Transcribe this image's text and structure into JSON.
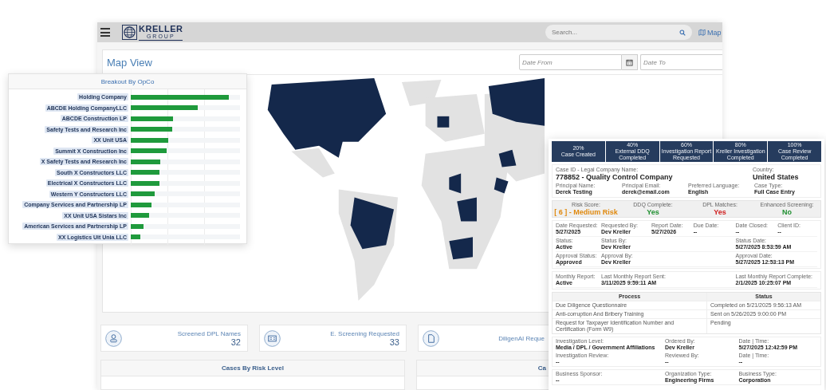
{
  "app": {
    "logo": {
      "name": "KRELLER",
      "subtitle": "GROUP"
    },
    "search": {
      "placeholder": "Search..."
    },
    "map_link": "Map"
  },
  "map_view": {
    "title": "Map View",
    "date_from": {
      "placeholder": "Date From"
    },
    "date_to": {
      "placeholder": "Date To"
    }
  },
  "stats": [
    {
      "label": "Screened DPL Names",
      "value": "32"
    },
    {
      "label": "E. Screening Requested",
      "value": "33"
    },
    {
      "label": "DiligenAI Reque"
    }
  ],
  "sections": [
    "Cases By Risk Level",
    "Ca"
  ],
  "opco_chart": {
    "title": "Breakout By OpCo",
    "rows": [
      {
        "label": "Holding Company",
        "level": 0.9
      },
      {
        "label": "ABCDE Holding CompanyLLC",
        "level": 0.61
      },
      {
        "label": "ABCDE Construction LP",
        "level": 0.39
      },
      {
        "label": "Safety Tests and Research Inc",
        "level": 0.38
      },
      {
        "label": "XX Unit USA",
        "level": 0.34
      },
      {
        "label": "Summit X Construction Inc",
        "level": 0.33
      },
      {
        "label": "X Safety Tests and Research Inc",
        "level": 0.27
      },
      {
        "label": "South X Constructors LLC",
        "level": 0.26
      },
      {
        "label": "Electrical X Constructors LLC",
        "level": 0.26
      },
      {
        "label": "Western Y Constructors LLC",
        "level": 0.22
      },
      {
        "label": "Company Services and Partnership LP",
        "level": 0.19
      },
      {
        "label": "XX Unit USA Sistars Inc",
        "level": 0.17
      },
      {
        "label": "American Services and Partnership LP",
        "level": 0.12
      },
      {
        "label": "XX Logistics Uit Unia LLC",
        "level": 0.09
      }
    ]
  },
  "case_detail": {
    "steps": [
      {
        "percent": "20%",
        "label": "Case Created"
      },
      {
        "percent": "40%",
        "label": "External DDQ Completed"
      },
      {
        "percent": "60%",
        "label": "Investigation Report Requested"
      },
      {
        "percent": "80%",
        "label": "Kreller Investigation Completed"
      },
      {
        "percent": "100%",
        "label": "Case Review Completed"
      }
    ],
    "company": {
      "label": "Case ID - Legal Company Name:",
      "value": "778852 - Quality Control Company"
    },
    "country": {
      "label": "Country:",
      "value": "United States"
    },
    "principal": [
      {
        "label": "Principal Name:",
        "value": "Derek Testing"
      },
      {
        "label": "Principal Email:",
        "value": "derek@email.com"
      },
      {
        "label": "Preferred Language:",
        "value": "English"
      },
      {
        "label": "Case Type:",
        "value": "Full Case Entry"
      }
    ],
    "flags": [
      {
        "label": "Risk Score:",
        "value": "[ 6 ] - Medium Risk",
        "color": "#e08a10"
      },
      {
        "label": "DDQ Complete:",
        "value": "Yes",
        "color": "#1f8f30"
      },
      {
        "label": "DPL Matches:",
        "value": "Yes",
        "color": "#d02020"
      },
      {
        "label": "Enhanced Screening:",
        "value": "No",
        "color": "#1f8f30"
      }
    ],
    "field_rows": [
      [
        {
          "label": "Date Requested:",
          "value": "5/27/2025"
        },
        {
          "label": "Requested By:",
          "value": "Dev Kreller"
        },
        {
          "label": "Report Date:",
          "value": "5/27/2026"
        },
        {
          "label": "Due Date:",
          "value": "--"
        },
        {
          "label": "Date Closed:",
          "value": "--"
        },
        {
          "label": "Client ID:",
          "value": "--"
        }
      ],
      [
        {
          "label": "Status:",
          "value": "Active"
        },
        {
          "label": "Status By:",
          "value": "Dev Kreller"
        },
        {
          "label": "Status Date:",
          "value": "5/27/2025 8:53:59 AM"
        }
      ],
      [
        {
          "label": "Approval Status:",
          "value": "Approved"
        },
        {
          "label": "Approval By:",
          "value": "Dev Kreller"
        },
        {
          "label": "Approval Date:",
          "value": "5/27/2025 12:53:13 PM"
        }
      ]
    ],
    "monthly": [
      {
        "label": "Monthly Report:",
        "value": "Active"
      },
      {
        "label": "Last Monthly Report Sent:",
        "value": "3/11/2025 9:59:11 AM"
      },
      {
        "label": "Last Monthly Report Complete:",
        "value": "2/1/2025 10:25:07 PM"
      }
    ],
    "process_table": {
      "columns": [
        "Process",
        "Status"
      ],
      "rows": [
        [
          "Due Diligence Questionnaire",
          "Completed on 5/21/2025 9:56:13 AM"
        ],
        [
          "Anti-corruption And Bribery Training",
          "Sent on 5/26/2025 9:00:00 PM"
        ],
        [
          "Request for Taxpayer Identification Number and Certification (Form W9)",
          "Pending"
        ]
      ]
    },
    "investigation_rows": [
      [
        {
          "label": "Investigation Level:",
          "value": "Media / DPL / Government Affiliations"
        },
        {
          "label": "Ordered By:",
          "value": "Dev Kreller"
        },
        {
          "label": "Date | Time:",
          "value": "5/27/2025 12:42:59 PM"
        }
      ],
      [
        {
          "label": "Investigation Review:",
          "value": "--"
        },
        {
          "label": "Reviewed By:",
          "value": "--"
        },
        {
          "label": "Date | Time:",
          "value": "--"
        }
      ],
      [
        {
          "label": "Business Sponsor:",
          "value": "--"
        },
        {
          "label": "Organization Type:",
          "value": "Engineering Firms"
        },
        {
          "label": "Business Type:",
          "value": "Corporation"
        }
      ]
    ]
  }
}
